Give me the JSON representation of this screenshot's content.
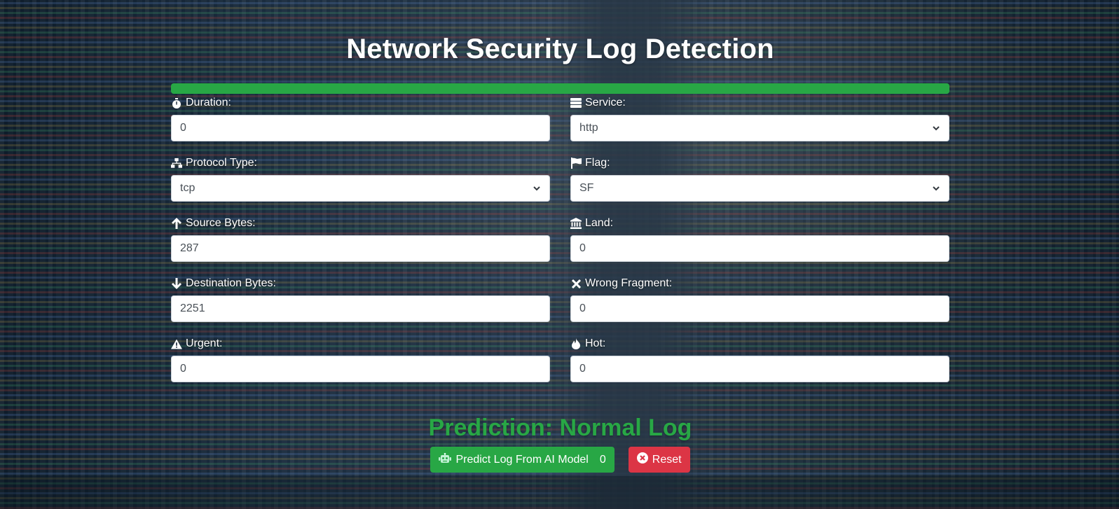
{
  "page": {
    "title": "Network Security Log Detection"
  },
  "progress": {
    "percent": 100,
    "color": "#28a745"
  },
  "fields": {
    "duration": {
      "label": "Duration:",
      "value": "0",
      "icon": "stopwatch-icon"
    },
    "service": {
      "label": "Service:",
      "value": "http",
      "icon": "server-icon"
    },
    "protocol_type": {
      "label": "Protocol Type:",
      "value": "tcp",
      "icon": "network-icon"
    },
    "flag": {
      "label": "Flag:",
      "value": "SF",
      "icon": "flag-icon"
    },
    "source_bytes": {
      "label": "Source Bytes:",
      "value": "287",
      "icon": "arrow-up-icon"
    },
    "land": {
      "label": "Land:",
      "value": "0",
      "icon": "landmark-icon"
    },
    "destination_bytes": {
      "label": "Destination Bytes:",
      "value": "2251",
      "icon": "arrow-down-icon"
    },
    "wrong_fragment": {
      "label": "Wrong Fragment:",
      "value": "0",
      "icon": "x-mark-icon"
    },
    "urgent": {
      "label": "Urgent:",
      "value": "0",
      "icon": "warning-icon"
    },
    "hot": {
      "label": "Hot:",
      "value": "0",
      "icon": "fire-icon"
    }
  },
  "prediction": {
    "text": "Prediction: Normal Log",
    "color": "#28a745"
  },
  "actions": {
    "predict_label": "Predict Log From AI Model",
    "predict_count": "0",
    "predict_icon": "robot-icon",
    "reset_label": "Reset",
    "reset_icon": "x-circle-icon"
  }
}
